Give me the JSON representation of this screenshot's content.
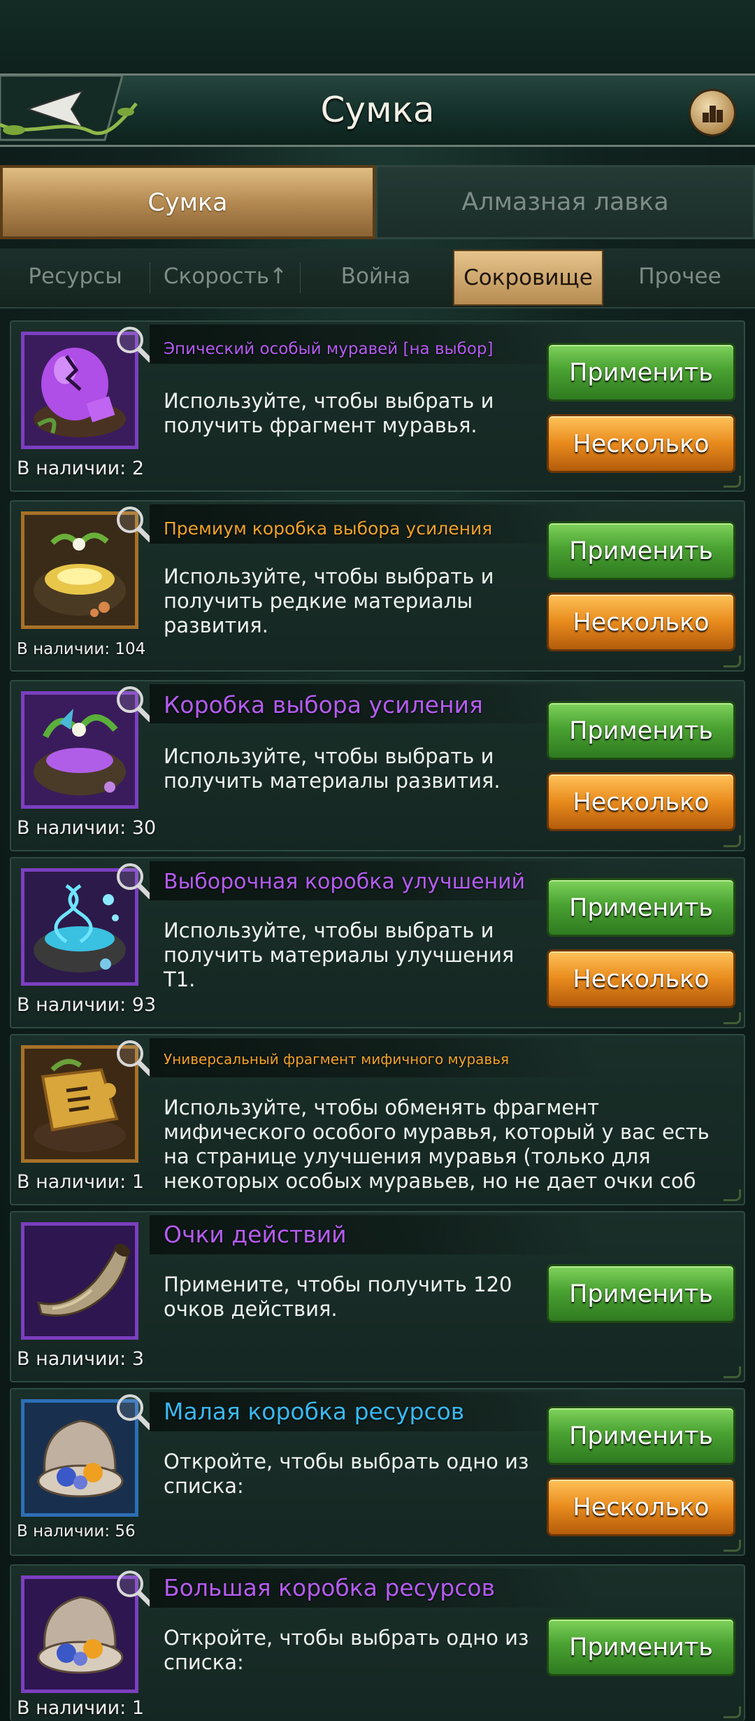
{
  "header": {
    "title": "Сумка"
  },
  "main_tabs": [
    {
      "label": "Сумка",
      "active": true
    },
    {
      "label": "Алмазная лавка",
      "active": false
    }
  ],
  "sub_tabs": [
    {
      "label": "Ресурсы"
    },
    {
      "label": "Скорость↑"
    },
    {
      "label": "Война"
    },
    {
      "label": "Сокровище",
      "active": true
    },
    {
      "label": "Прочее"
    }
  ],
  "buttons": {
    "apply": "Применить",
    "multiple": "Несколько"
  },
  "items": [
    {
      "name": "Эпический особый муравей [на выбор]",
      "description": "Используйте, чтобы выбрать и получить фрагмент муравья.",
      "count": "В наличии: 2",
      "rarity": "epic",
      "name_color": "#b45cf0",
      "icon": "purple-egg-icon"
    },
    {
      "name": "Премиум коробка выбора усиления",
      "description": "Используйте, чтобы выбрать и получить редкие материалы развития.",
      "count": "В наличии: 104",
      "rarity": "legendary",
      "name_color": "#f0a22a",
      "icon": "golden-nest-icon"
    },
    {
      "name": "Коробка выбора усиления",
      "description": "Используйте, чтобы выбрать и получить материалы развития.",
      "count": "В наличии: 30",
      "rarity": "epic",
      "name_color": "#b45cf0",
      "icon": "purple-nest-icon"
    },
    {
      "name": "Выборочная коробка улучшений",
      "description": "Используйте, чтобы выбрать и получить материалы улучшения Т1.",
      "count": "В наличии: 93",
      "rarity": "epic",
      "name_color": "#b45cf0",
      "icon": "dna-nest-icon"
    },
    {
      "name": "Универсальный фрагмент мифичного муравья",
      "description": "Используйте, чтобы обменять фрагмент мифического особого муравья, который у вас есть на странице улучшения муравья (только для некоторых особых муравьев, но не дает очки соб",
      "count": "В наличии: 1",
      "rarity": "legendary",
      "name_color": "#f0a22a",
      "icon": "puzzle-fragment-icon"
    },
    {
      "name": "Очки действий",
      "description": "Примените, чтобы получить 120 очков действия.",
      "count": "В наличии: 3",
      "rarity": "epic",
      "name_color": "#b45cf0",
      "icon": "horn-icon"
    },
    {
      "name": "Малая коробка ресурсов",
      "description": "Откройте, чтобы выбрать одно из списка:",
      "count": "В наличии: 56",
      "rarity": "rare",
      "name_color": "#3ab8f0",
      "icon": "resource-shell-icon"
    },
    {
      "name": "Большая коробка ресурсов",
      "description": "Откройте, чтобы выбрать одно из списка:",
      "count": "В наличии: 1",
      "rarity": "epic",
      "name_color": "#b45cf0",
      "icon": "resource-shell-icon"
    }
  ]
}
